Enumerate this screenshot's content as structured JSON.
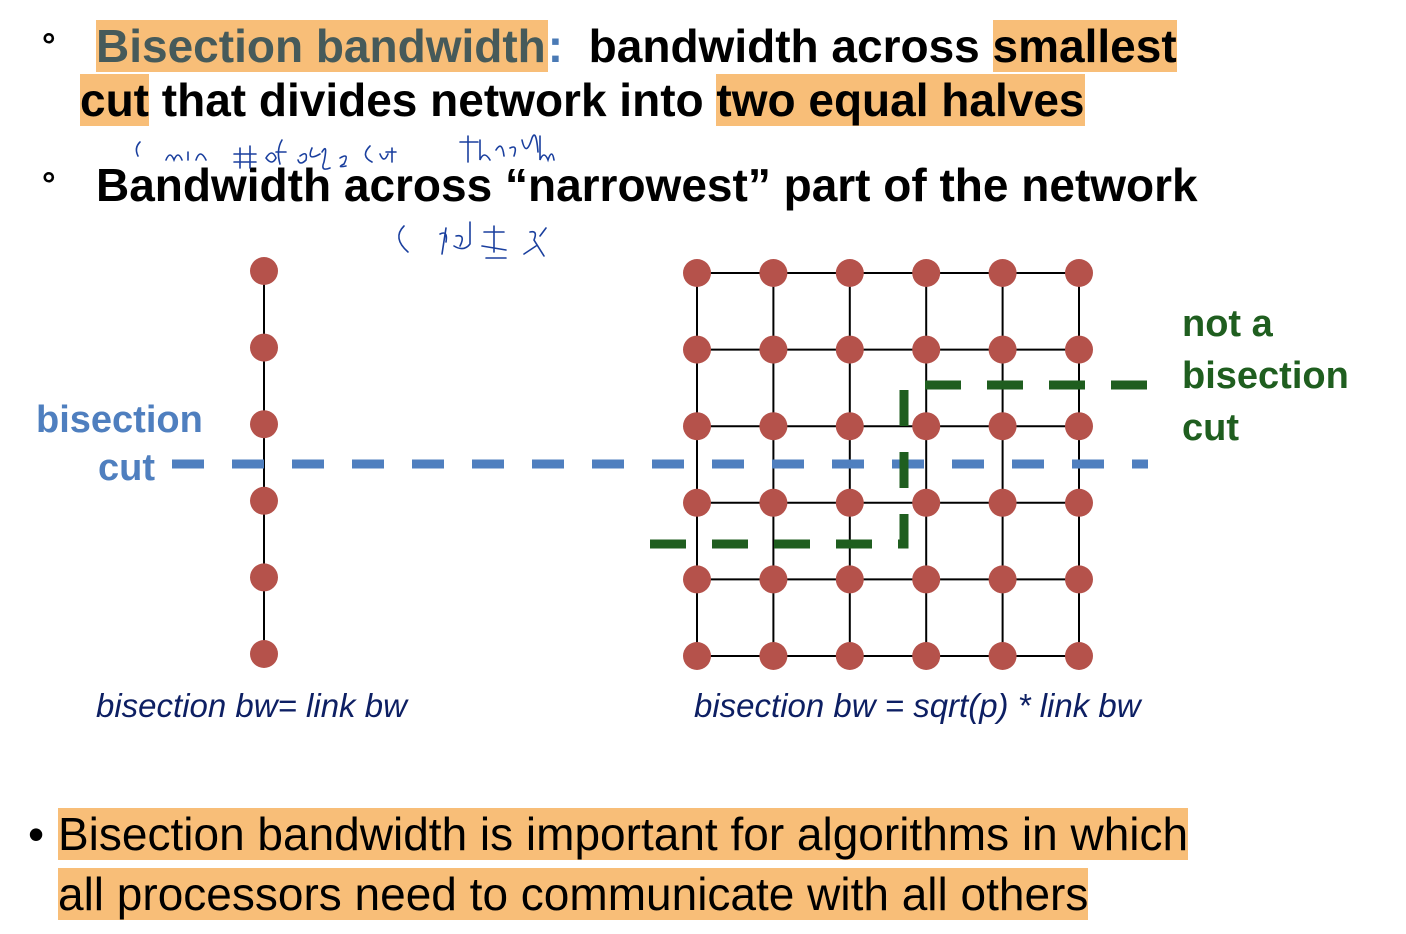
{
  "bullet1": {
    "marker": "°",
    "term": "Bisection bandwidth",
    "colon": ":",
    "text_a": "bandwidth across",
    "smallest": "smallest",
    "cut": "cut",
    "text_b": " that divides network into ",
    "halves": "two equal halves"
  },
  "bullet2": {
    "marker": "°",
    "text": "Bandwidth across “narrowest” part of the network"
  },
  "labels": {
    "bisection_line1": "bisection",
    "bisection_line2": "cut",
    "not_a_line1": "not a",
    "not_a_line2": "bisection",
    "not_a_line3": "cut"
  },
  "captions": {
    "left": "bisection bw= link bw",
    "right": "bisection bw = sqrt(p) * link bw"
  },
  "bullet3": {
    "marker": "•",
    "line1": "Bisection bandwidth is important for algorithms in which",
    "line2": "all processors need to communicate with all others"
  },
  "colors": {
    "node": "#b5524b",
    "bisection_cut": "#4f7fbf",
    "not_bisection_cut": "#1f5e1f",
    "highlight": "#f8be78",
    "handwriting": "#1a3f9e"
  },
  "diagram": {
    "linear_nodes": 6,
    "mesh_rows": 6,
    "mesh_cols": 6
  }
}
